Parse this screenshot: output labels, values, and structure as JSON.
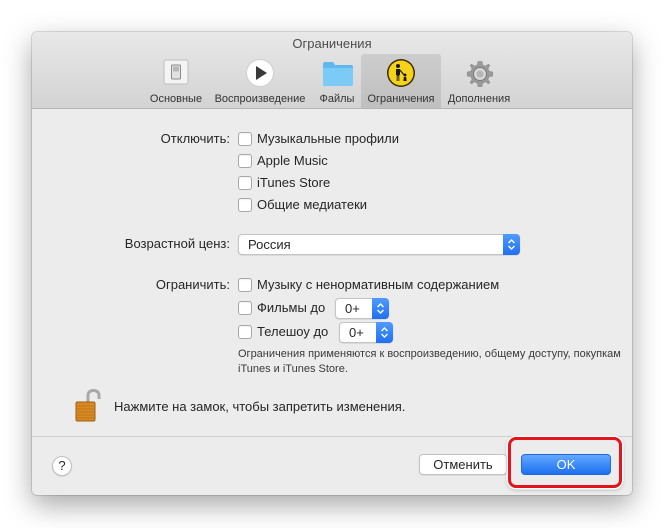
{
  "window": {
    "title": "Ограничения"
  },
  "toolbar": {
    "tabs": [
      {
        "label": "Основные",
        "icon": "switch-icon",
        "selected": false
      },
      {
        "label": "Воспроизведение",
        "icon": "play-icon",
        "selected": false
      },
      {
        "label": "Файлы",
        "icon": "folder-icon",
        "selected": false
      },
      {
        "label": "Ограничения",
        "icon": "parental-controls-icon",
        "selected": true
      },
      {
        "label": "Дополнения",
        "icon": "gear-icon",
        "selected": false
      }
    ]
  },
  "disable": {
    "label": "Отключить:",
    "options": [
      {
        "label": "Музыкальные профили",
        "checked": false
      },
      {
        "label": "Apple Music",
        "checked": false
      },
      {
        "label": "iTunes Store",
        "checked": false
      },
      {
        "label": "Общие медиатеки",
        "checked": false
      }
    ]
  },
  "ratings": {
    "label": "Возрастной ценз:",
    "value": "Россия"
  },
  "restrict": {
    "label": "Ограничить:",
    "explicit_music": {
      "label": "Музыку с ненормативным содержанием",
      "checked": false
    },
    "movies": {
      "label": "Фильмы до",
      "checked": false,
      "value": "0+"
    },
    "tv_shows": {
      "label": "Телешоу до",
      "checked": false,
      "value": "0+"
    },
    "note": "Ограничения применяются к воспроизведению, общему доступу, покупкам iTunes и iTunes Store."
  },
  "lock": {
    "icon": "unlocked-padlock-icon",
    "text": "Нажмите на замок, чтобы запретить изменения."
  },
  "footer": {
    "help_label": "?",
    "cancel_label": "Отменить",
    "ok_label": "OK"
  },
  "colors": {
    "accent": "#1f6ff2",
    "highlight": "#e3151d",
    "window_bg": "#ececec"
  }
}
